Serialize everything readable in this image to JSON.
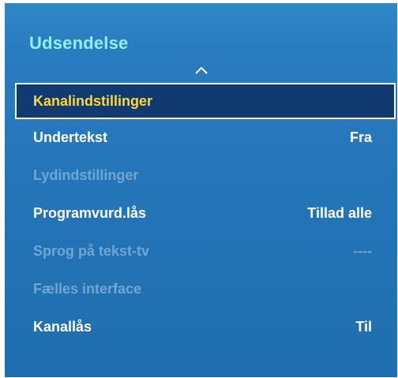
{
  "menu": {
    "title": "Udsendelse",
    "items": [
      {
        "label": "Kanalindstillinger",
        "value": ""
      },
      {
        "label": "Undertekst",
        "value": "Fra"
      },
      {
        "label": "Lydindstillinger",
        "value": ""
      },
      {
        "label": "Programvurd.lås",
        "value": "Tillad alle"
      },
      {
        "label": "Sprog på tekst-tv",
        "value": "----"
      },
      {
        "label": "Fælles interface",
        "value": ""
      },
      {
        "label": "Kanallås",
        "value": "Til"
      }
    ]
  },
  "icons": {
    "scroll_up": "chevron-up-icon"
  },
  "colors": {
    "panel": "#2475b8",
    "title": "#8ff0ff",
    "selected_bg": "#103a70",
    "selected_text": "#ffd832",
    "disabled_text": "#6fa6d2"
  }
}
